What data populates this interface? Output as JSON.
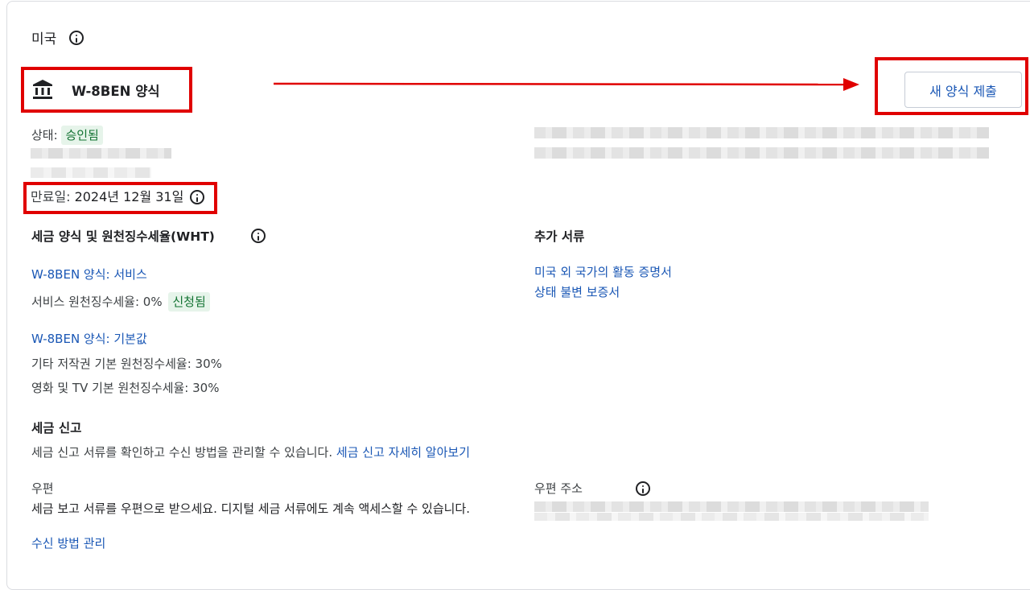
{
  "country": {
    "title": "미국"
  },
  "form": {
    "title": "W-8BEN 양식"
  },
  "submit_button": "새 양식 제출",
  "status": {
    "label": "상태:",
    "value": "승인됨"
  },
  "expiry": {
    "label": "만료일:",
    "date": "2024년 12월 31일"
  },
  "wht": {
    "heading": "세금 양식 및 원천징수세율(WHT)",
    "services_link": "W-8BEN 양식: 서비스",
    "services_rate": "서비스 원천징수세율: 0%",
    "services_chip": "신청됨",
    "default_link": "W-8BEN 양식: 기본값",
    "copyright_rate": "기타 저작권 기본 원천징수세율: 30%",
    "film_rate": "영화 및 TV 기본 원천징수세율: 30%"
  },
  "additional_docs": {
    "heading": "추가 서류",
    "links": [
      "미국 외 국가의 활동 증명서",
      "상태 불변 보증서"
    ]
  },
  "tax_reporting": {
    "heading": "세금 신고",
    "description": "세금 신고 서류를 확인하고 수신 방법을 관리할 수 있습니다.",
    "learn_more": "세금 신고 자세히 알아보기"
  },
  "mail": {
    "label": "우편",
    "description": "세금 보고 서류를 우편으로 받으세요. 디지털 세금 서류에도 계속 액세스할 수 있습니다.",
    "address_label": "우편 주소",
    "manage_link": "수신 방법 관리"
  },
  "colors": {
    "link": "#1a57b5",
    "annotation": "#e00000",
    "chip_bg": "#e6f4ea"
  }
}
